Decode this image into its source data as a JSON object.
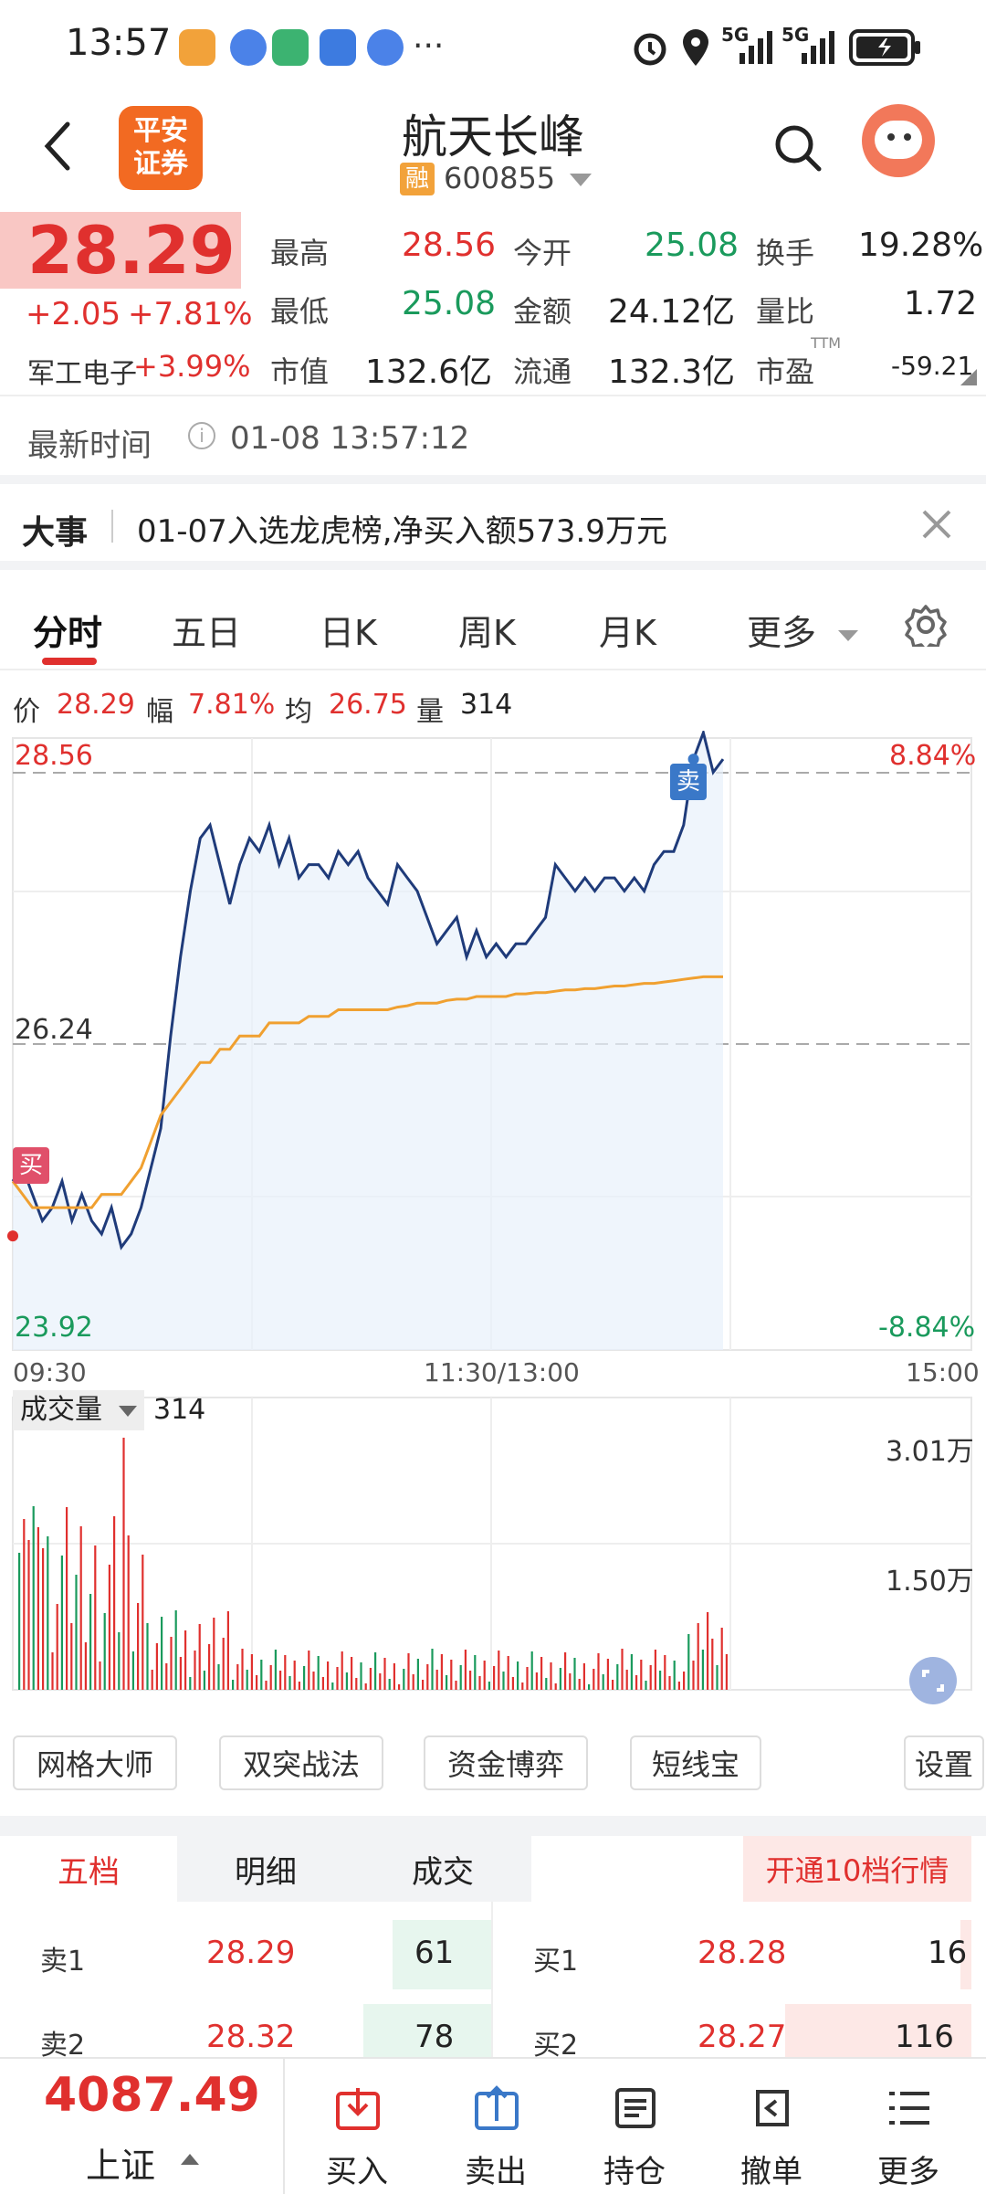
{
  "status_bar": {
    "time": "13:57",
    "network": "5G",
    "network2": "5G"
  },
  "header": {
    "back_icon": "back-arrow-icon",
    "logo_line1": "平安",
    "logo_line2": "证券",
    "title": "航天长峰",
    "badge": "融",
    "code": "600855"
  },
  "quote": {
    "price": "28.29",
    "change": "+2.05",
    "change_pct": "+7.81%",
    "sector_name": "军工电子",
    "sector_pct": "+3.99%",
    "fields": [
      {
        "label": "最高",
        "value": "28.56"
      },
      {
        "label": "今开",
        "value": "25.08"
      },
      {
        "label": "换手",
        "value": "19.28%"
      },
      {
        "label": "最低",
        "value": "25.08"
      },
      {
        "label": "金额",
        "value": "24.12亿"
      },
      {
        "label": "量比",
        "value": "1.72"
      },
      {
        "label": "市值",
        "value": "132.6亿"
      },
      {
        "label": "流通",
        "value": "132.3亿"
      },
      {
        "label": "市盈",
        "value": "-59.21",
        "sup": "TTM"
      }
    ]
  },
  "update": {
    "label": "最新时间",
    "time": "01-08 13:57:12"
  },
  "event": {
    "tag": "大事",
    "text": "01-07入选龙虎榜,净买入额573.9万元"
  },
  "tabs": [
    "分时",
    "五日",
    "日K",
    "周K",
    "月K",
    "更多"
  ],
  "active_tab": "分时",
  "info": {
    "price_label": "价",
    "price": "28.29",
    "amp_label": "幅",
    "amp": "7.81%",
    "avg_label": "均",
    "avg": "26.75",
    "vol_label": "量",
    "vol": "314"
  },
  "chart": {
    "y_high": "28.56",
    "y_mid": "26.24",
    "y_low": "23.92",
    "pct_high": "8.84%",
    "pct_low": "-8.84%",
    "x_start": "09:30",
    "x_mid": "11:30/13:00",
    "x_end": "15:00",
    "buy_marker": "买",
    "sell_marker": "卖",
    "volume_label": "成交量",
    "volume_value": "314",
    "vol_max": "3.01万",
    "vol_mid": "1.50万"
  },
  "chart_data": {
    "type": "line",
    "ylim": [
      23.92,
      28.56
    ],
    "series": [
      {
        "values": [
          25.2,
          25.3,
          25.1,
          24.9,
          25.0,
          25.2,
          24.9,
          25.1,
          24.9,
          24.8,
          25.0,
          24.7,
          24.8,
          25.0,
          25.3,
          25.6,
          26.3,
          26.9,
          27.4,
          27.8,
          27.9,
          27.6,
          27.3,
          27.6,
          27.8,
          27.7,
          27.9,
          27.6,
          27.8,
          27.5,
          27.6,
          27.6,
          27.5,
          27.7,
          27.6,
          27.7,
          27.5,
          27.4,
          27.3,
          27.6,
          27.5,
          27.4,
          27.2,
          27.0,
          27.1,
          27.2,
          26.9,
          27.1,
          26.9,
          27.0,
          26.9,
          27.0,
          27.0,
          27.1,
          27.2,
          27.6,
          27.5,
          27.4,
          27.5,
          27.4,
          27.5,
          27.5,
          27.4,
          27.5,
          27.4,
          27.6,
          27.7,
          27.7,
          27.9,
          28.4,
          28.6,
          28.3,
          28.4
        ]
      },
      {
        "values": [
          25.2,
          25.1,
          25.0,
          25.0,
          25.0,
          25.0,
          25.0,
          25.0,
          25.0,
          25.1,
          25.1,
          25.1,
          25.2,
          25.3,
          25.5,
          25.7,
          25.8,
          25.9,
          26.0,
          26.1,
          26.1,
          26.2,
          26.2,
          26.3,
          26.3,
          26.3,
          26.4,
          26.4,
          26.4,
          26.4,
          26.45,
          26.45,
          26.45,
          26.5,
          26.5,
          26.5,
          26.5,
          26.5,
          26.5,
          26.52,
          26.53,
          26.55,
          26.55,
          26.55,
          26.57,
          26.58,
          26.58,
          26.6,
          26.6,
          26.6,
          26.6,
          26.62,
          26.62,
          26.63,
          26.63,
          26.64,
          26.65,
          26.65,
          26.66,
          26.66,
          26.67,
          26.68,
          26.68,
          26.69,
          26.7,
          26.7,
          26.71,
          26.72,
          26.73,
          26.74,
          26.75,
          26.75,
          26.75
        ]
      }
    ]
  },
  "tools": [
    "网格大师",
    "双突战法",
    "资金博弈",
    "短线宝",
    "设置"
  ],
  "order_tabs": [
    "五档",
    "明细",
    "成交"
  ],
  "upgrade_label": "开通10档行情",
  "order_book": [
    {
      "side": "卖1",
      "price": "28.29",
      "qty": "61",
      "bside": "买1",
      "bprice": "28.28",
      "bqty": "16"
    },
    {
      "side": "卖2",
      "price": "28.32",
      "qty": "78",
      "bside": "买2",
      "bprice": "28.27",
      "bqty": "116"
    }
  ],
  "index": {
    "value": "4087.49",
    "name": "上证"
  },
  "bottom_nav": [
    "买入",
    "卖出",
    "持仓",
    "撤单",
    "更多"
  ],
  "colors": {
    "up": "#e0302e",
    "down": "#1a9a5c",
    "line": "#1f3b7a",
    "avg": "#f0a030",
    "accent": "#3a78c8"
  }
}
